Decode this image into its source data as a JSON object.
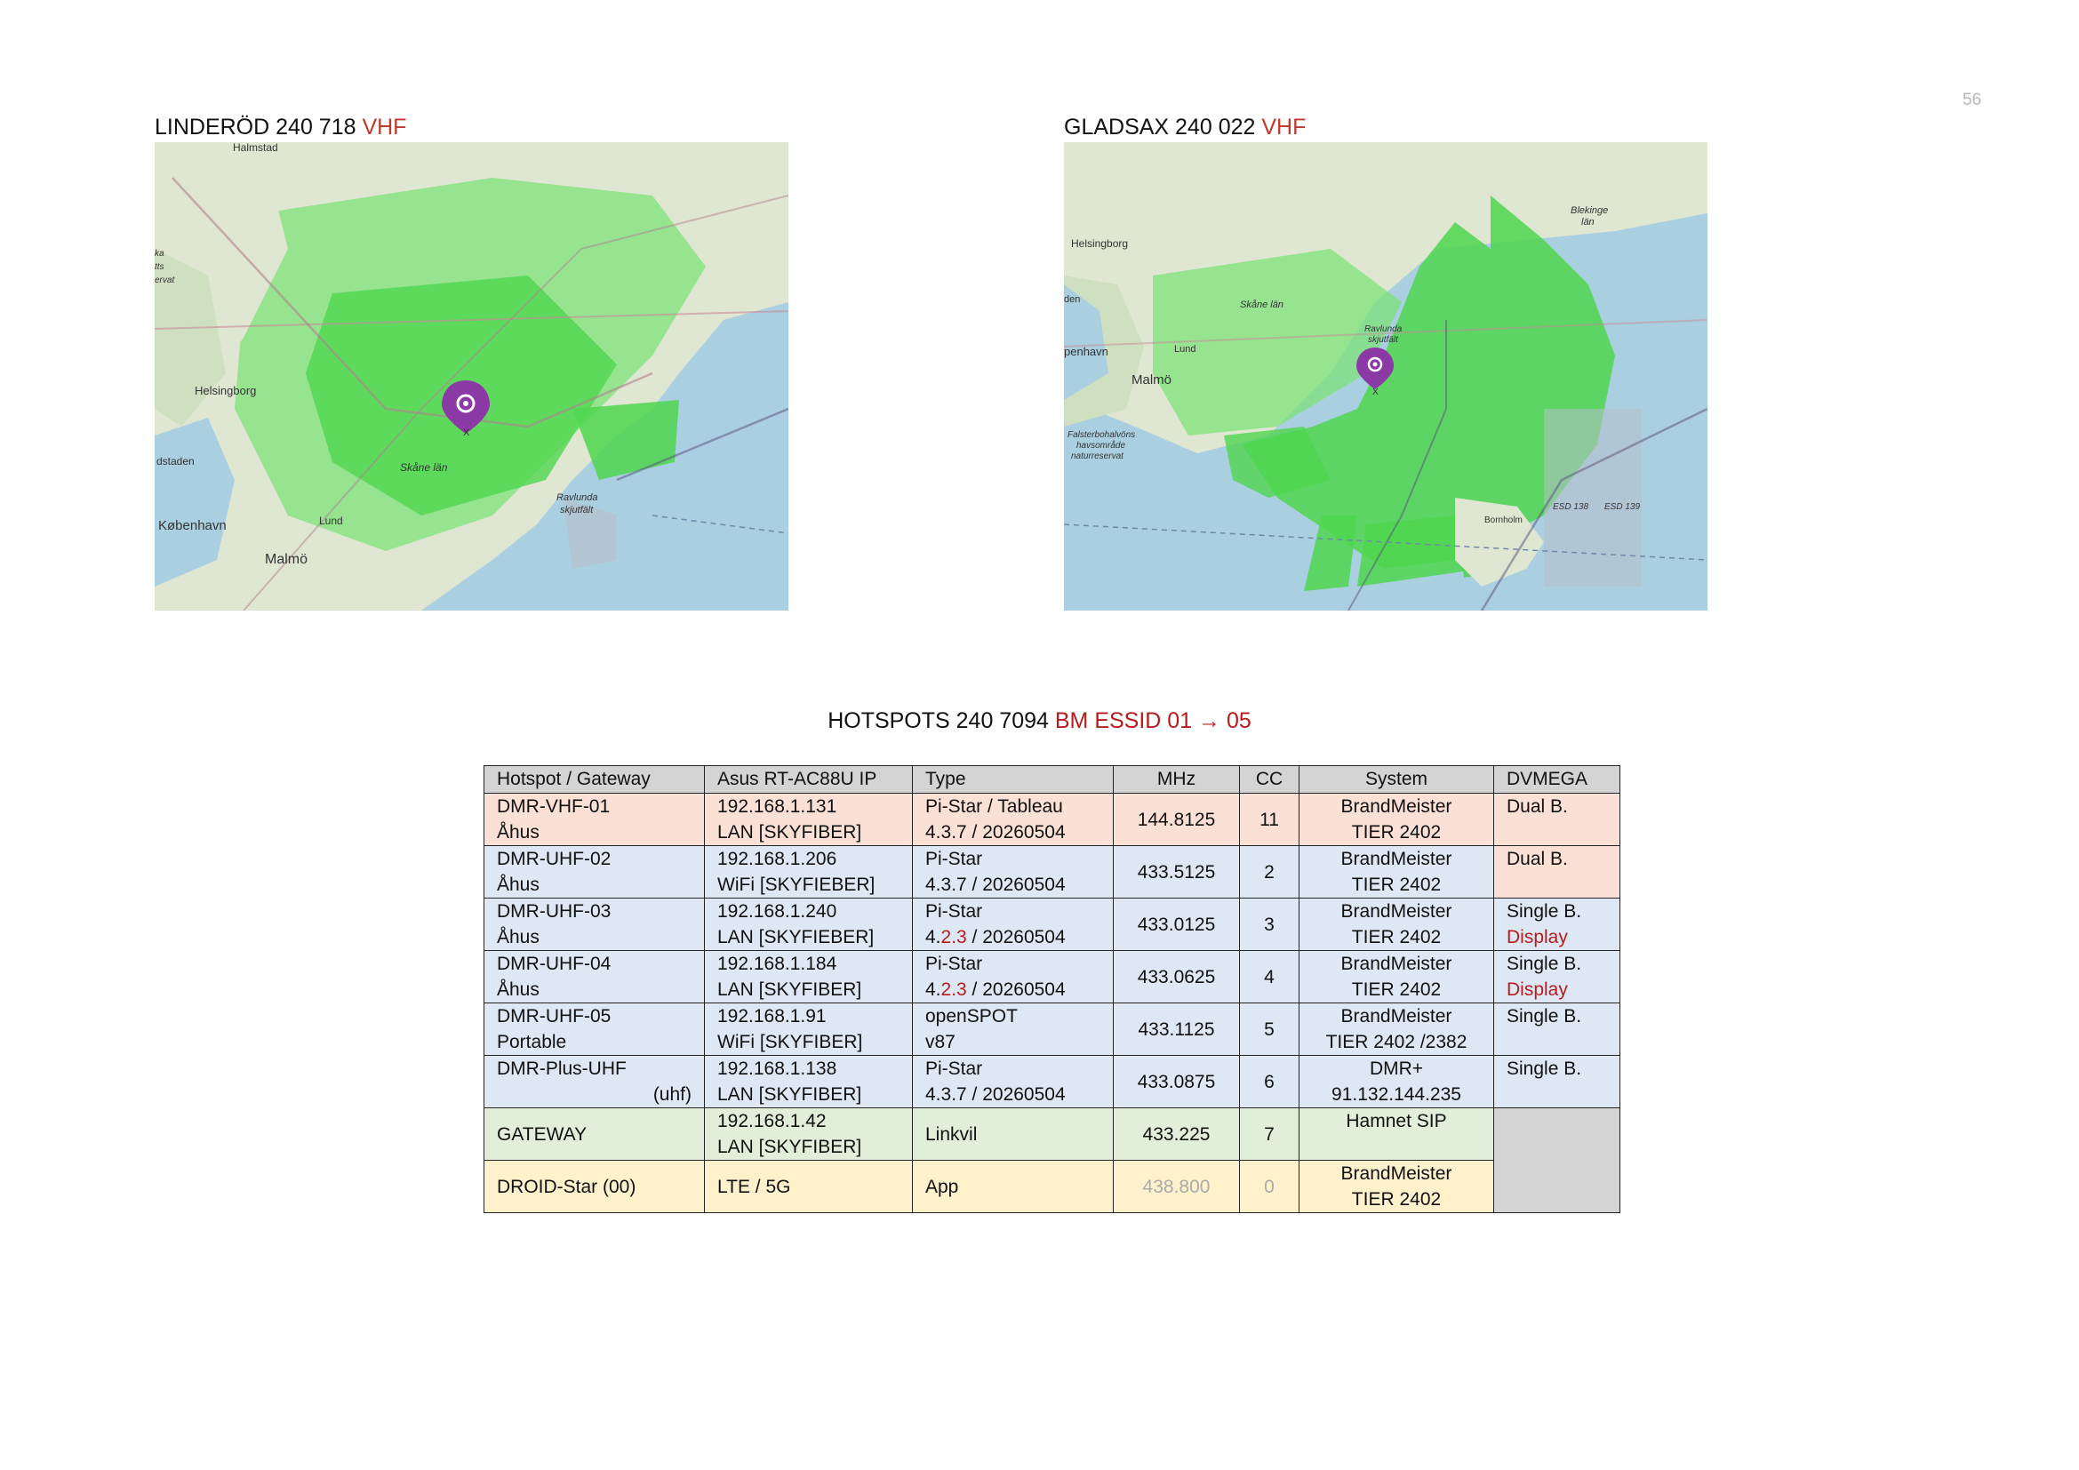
{
  "page_number": "56",
  "maps": [
    {
      "title_black": "LINDERÖD 240 718 ",
      "title_red": "VHF",
      "labels": [
        "Halmstad",
        "Helsingborg",
        "København",
        "Malmö",
        "Lund",
        "Skåne län",
        "Ravlunda skjutfält",
        "dstaden",
        "ka tts ervat"
      ],
      "marker_label": "X"
    },
    {
      "title_black": "GLADSAX 240 022 ",
      "title_red": "VHF",
      "labels": [
        "Helsingborg",
        "Malmö",
        "Lund",
        "Skåne län",
        "Ravlunda skjutfält",
        "Blekinge län",
        "penhavn",
        "Falsterbohalvöns havsområde naturreservat",
        "Bornholm",
        "ESD 138",
        "ESD 139",
        "den"
      ],
      "marker_label": "X"
    }
  ],
  "hotspots": {
    "title_black": "HOTSPOTS 240 7094 ",
    "title_red": "BM ESSID 01 → 05",
    "headers": [
      "Hotspot / Gateway",
      "Asus RT-AC88U IP",
      "Type",
      "MHz",
      "CC",
      "System",
      "DVMEGA"
    ],
    "rows": [
      {
        "name1": "DMR-VHF-01",
        "name2": "Åhus",
        "ip1": "192.168.1.131",
        "ip2": "LAN [SKYFIBER]",
        "type1": "Pi-Star / Tableau",
        "type2": "4.3.7 / 20260504",
        "mhz": "144.8125",
        "cc": "11",
        "sys1": "BrandMeister",
        "sys2": "TIER 2402",
        "dv1": "Dual B.",
        "dv2": ""
      },
      {
        "name1": "DMR-UHF-02",
        "name2": "Åhus",
        "ip1": "192.168.1.206",
        "ip2": "WiFi [SKYFIEBER]",
        "type1": "Pi-Star",
        "type2": "4.3.7 / 20260504",
        "mhz": "433.5125",
        "cc": "2",
        "sys1": "BrandMeister",
        "sys2": "TIER 2402",
        "dv1": "Dual B.",
        "dv2": ""
      },
      {
        "name1": "DMR-UHF-03",
        "name2": "Åhus",
        "ip1": "192.168.1.240",
        "ip2": "LAN [SKYFIEBER]",
        "type1": "Pi-Star",
        "type2_a": "4.",
        "type2_red": "2.3",
        "type2_b": " / 20260504",
        "mhz": "433.0125",
        "cc": "3",
        "sys1": "BrandMeister",
        "sys2": "TIER 2402",
        "dv1": "Single B.",
        "dv2": "Display"
      },
      {
        "name1": "DMR-UHF-04",
        "name2": "Åhus",
        "ip1": "192.168.1.184",
        "ip2": "LAN [SKYFIBER]",
        "type1": "Pi-Star",
        "type2_a": "4.",
        "type2_red": "2.3",
        "type2_b": " / 20260504",
        "mhz": "433.0625",
        "cc": "4",
        "sys1": "BrandMeister",
        "sys2": "TIER 2402",
        "dv1": "Single B.",
        "dv2": "Display"
      },
      {
        "name1": "DMR-UHF-05",
        "name2": "Portable",
        "ip1": "192.168.1.91",
        "ip2": "WiFi [SKYFIBER]",
        "type1": "openSPOT",
        "type2": "v87",
        "mhz": "433.1125",
        "cc": "5",
        "sys1": "BrandMeister",
        "sys2": "TIER 2402 /2382",
        "dv1": "Single B.",
        "dv2": ""
      },
      {
        "name1": "DMR-Plus-UHF",
        "name2": "(uhf)",
        "ip1": "192.168.1.138",
        "ip2": "LAN [SKYFIBER]",
        "type1": "Pi-Star",
        "type2": "4.3.7 / 20260504",
        "mhz": "433.0875",
        "cc": "6",
        "sys1": "DMR+",
        "sys2": "91.132.144.235",
        "dv1": "Single B.",
        "dv2": ""
      },
      {
        "name1": "GATEWAY",
        "ip1": "192.168.1.42",
        "ip2": "LAN [SKYFIBER]",
        "type1": "Linkvil",
        "mhz": "433.225",
        "cc": "7",
        "sys1": "Hamnet SIP"
      },
      {
        "name1": "DROID-Star (00)",
        "ip1": "LTE / 5G",
        "type1": "App",
        "mhz": "438.800",
        "cc": "0",
        "sys1": "BrandMeister",
        "sys2": "TIER 2402"
      }
    ]
  }
}
